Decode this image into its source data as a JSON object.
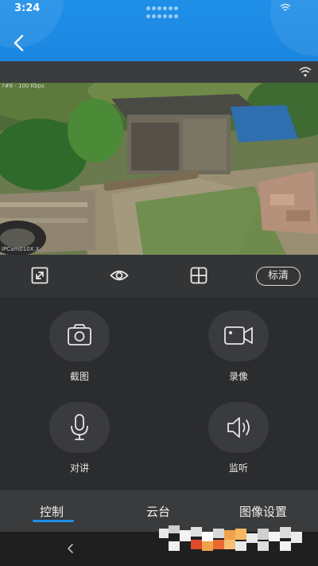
{
  "status_bar": {
    "time": "3:24"
  },
  "video": {
    "osd_top": "?#8 - 100 Kbps",
    "osd_bottom": "IPCam010X.X"
  },
  "toolbar": {
    "quality_label": "标清"
  },
  "controls": {
    "screenshot_label": "截图",
    "record_label": "录像",
    "talk_label": "对讲",
    "listen_label": "监听"
  },
  "tabs": {
    "control": "控制",
    "ptz": "云台",
    "image_settings": "图像设置",
    "active": "控制"
  },
  "colors": {
    "header_blue": "#1f8fe8",
    "accent": "#1e8fe6",
    "panel": "#2b2c2e"
  }
}
